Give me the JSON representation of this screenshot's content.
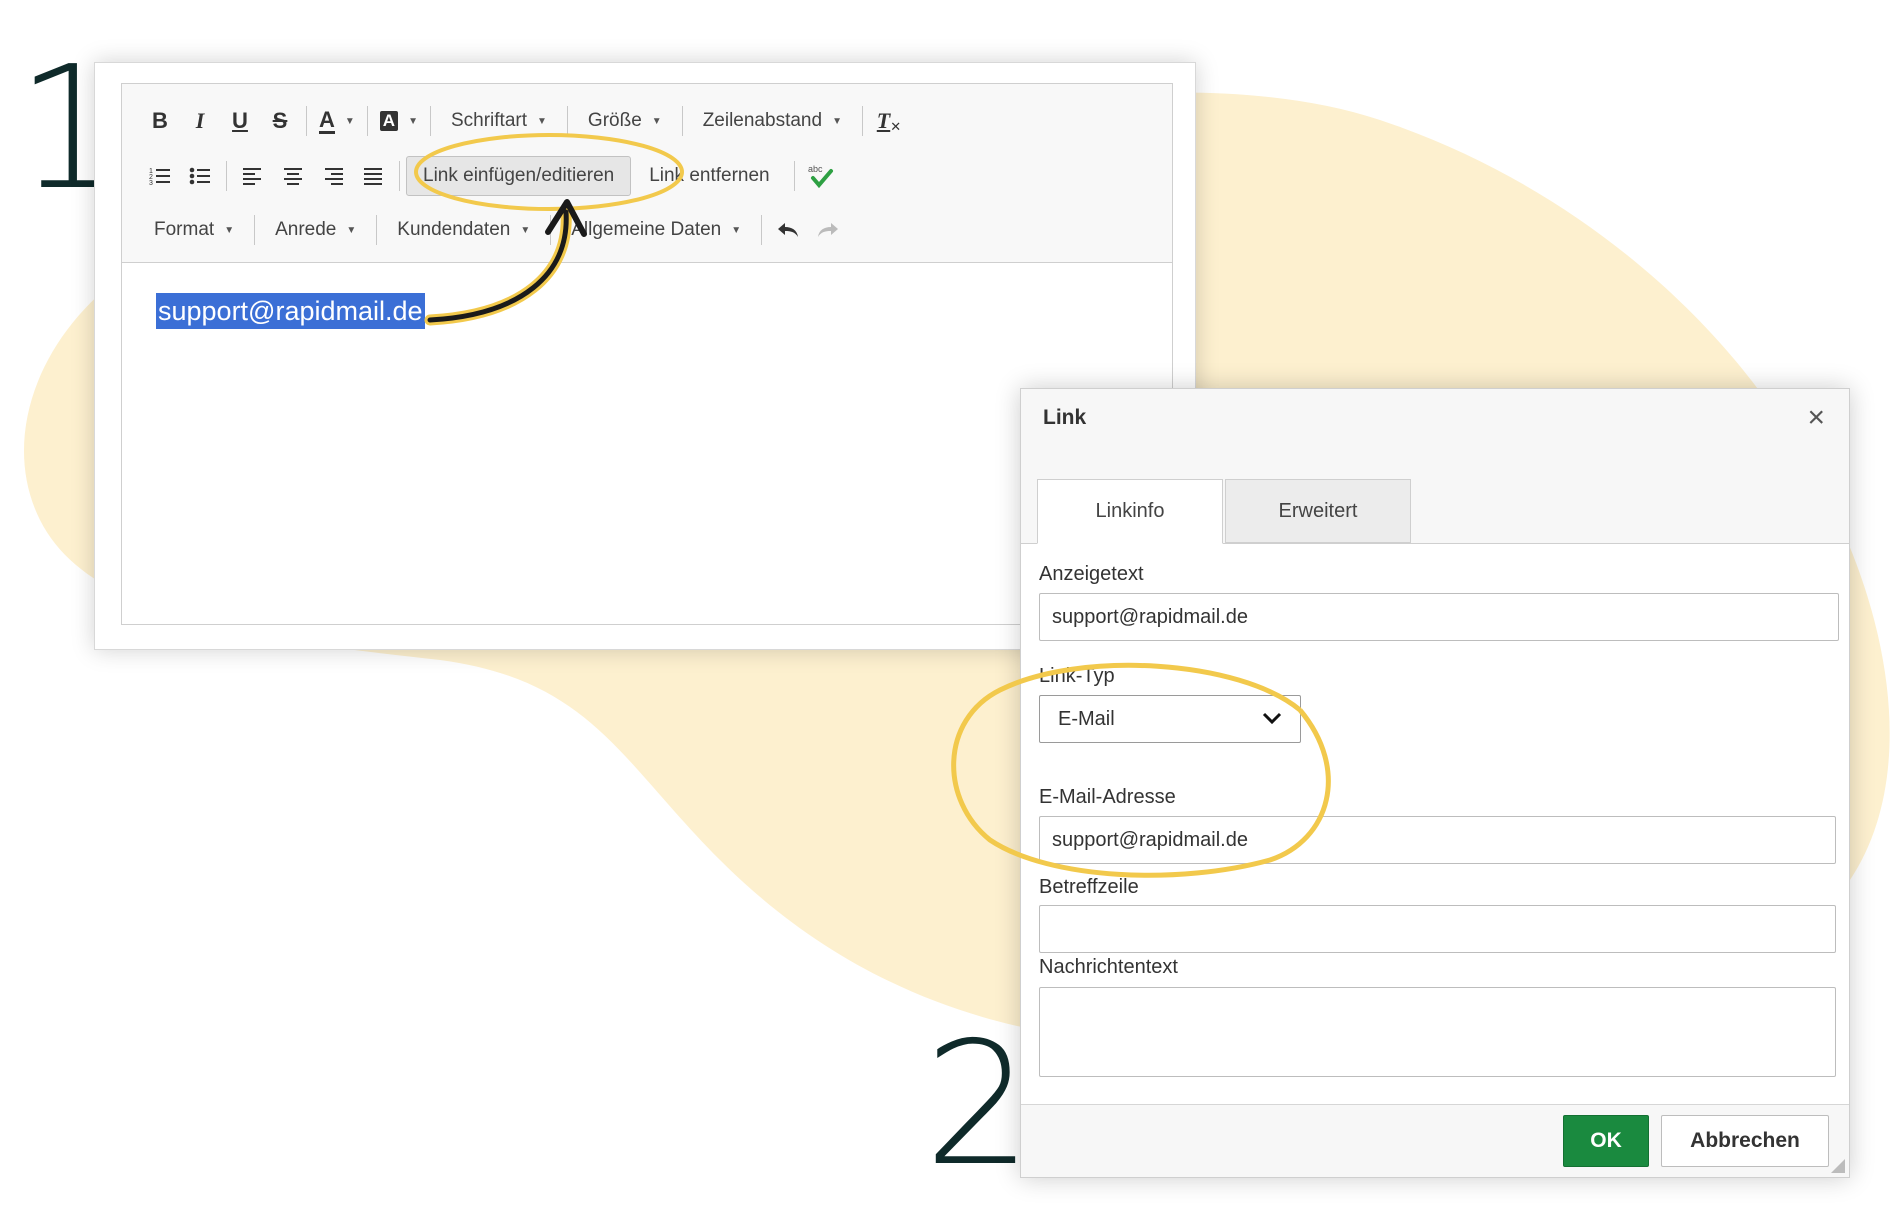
{
  "steps": {
    "one": "1",
    "two": "2"
  },
  "colors": {
    "blob": "#fdf0cf",
    "highlight_ring": "#f2c94c",
    "selection": "#3b6fd6",
    "ok_button": "#1a8a3f"
  },
  "editor": {
    "toolbar": {
      "bold": "B",
      "italic": "I",
      "underline": "U",
      "strike": "S",
      "text_color": "A",
      "bg_color": "A",
      "font_menu": "Schriftart",
      "size_menu": "Größe",
      "line_height_menu": "Zeilenabstand",
      "clear_format": "T",
      "insert_link": "Link einfügen/editieren",
      "remove_link": "Link entfernen",
      "spellcheck_badge": "abc",
      "format_menu": "Format",
      "salutation_menu": "Anrede",
      "customer_data_menu": "Kundendaten",
      "general_data_menu": "Allgemeine Daten"
    },
    "icons": {
      "numbered_list": "numbered-list-icon",
      "bullet_list": "bullet-list-icon",
      "align_left": "align-left-icon",
      "align_center": "align-center-icon",
      "align_right": "align-right-icon",
      "justify": "justify-icon",
      "spellcheck": "spellcheck-icon",
      "undo": "undo-icon",
      "redo": "redo-icon"
    },
    "content": {
      "selected_text": "support@rapidmail.de"
    }
  },
  "dialog": {
    "title": "Link",
    "close": "×",
    "tabs": [
      {
        "label": "Linkinfo"
      },
      {
        "label": "Erweitert"
      }
    ],
    "fields": {
      "display_text_label": "Anzeigetext",
      "display_text_value": "support@rapidmail.de",
      "link_type_label": "Link-Typ",
      "link_type_value": "E-Mail",
      "email_label": "E-Mail-Adresse",
      "email_value": "support@rapidmail.de",
      "subject_label": "Betreffzeile",
      "subject_value": "",
      "body_label": "Nachrichtentext",
      "body_value": ""
    },
    "buttons": {
      "ok": "OK",
      "cancel": "Abbrechen"
    }
  }
}
